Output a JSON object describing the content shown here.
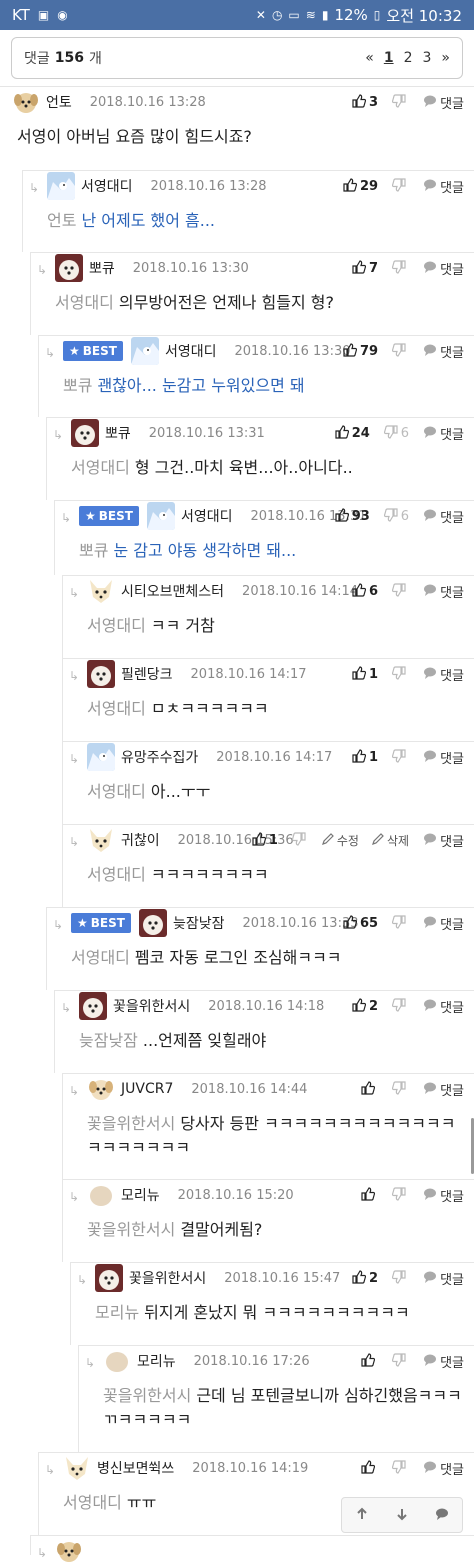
{
  "status": {
    "carrier": "KT",
    "battery": "12%",
    "time": "오전 10:32"
  },
  "header": {
    "label": "댓글",
    "count": "156",
    "unit": "개",
    "pages": [
      "«",
      "1",
      "2",
      "3",
      "»"
    ]
  },
  "best_label": "BEST",
  "reply_label": "댓글",
  "edit_label": "수정",
  "delete_label": "삭제",
  "comments": [
    {
      "nick": "언토",
      "date": "2018.10.16 13:28",
      "up": "3",
      "down": "",
      "mention": "",
      "text": "서영이 아버님 요즘 많이 힘드시죠?"
    },
    {
      "nick": "서영대디",
      "date": "2018.10.16 13:28",
      "up": "29",
      "down": "",
      "mention": "언토",
      "text": "난 어제도 했어 흠..."
    },
    {
      "nick": "뽀큐",
      "date": "2018.10.16 13:30",
      "up": "7",
      "down": "",
      "mention": "서영대디",
      "text": "의무방어전은 언제나 힘들지 형?"
    },
    {
      "nick": "서영대디",
      "date": "2018.10.16 13:30",
      "up": "79",
      "down": "",
      "mention": "뽀큐",
      "text": "괜찮아... 눈감고 누워있으면 돼"
    },
    {
      "nick": "뽀큐",
      "date": "2018.10.16 13:31",
      "up": "24",
      "down": "6",
      "mention": "서영대디",
      "text": "형 그건..마치 육변...아..아니다.."
    },
    {
      "nick": "서영대디",
      "date": "2018.10.16 13:31",
      "up": "93",
      "down": "6",
      "mention": "뽀큐",
      "text": "눈 감고 야동 생각하면 돼..."
    },
    {
      "nick": "시티오브맨체스터",
      "date": "2018.10.16 14:14",
      "up": "6",
      "down": "",
      "mention": "서영대디",
      "text": "ㅋㅋ 거참"
    },
    {
      "nick": "필렌당크",
      "date": "2018.10.16 14:17",
      "up": "1",
      "down": "",
      "mention": "서영대디",
      "text": "ㅁㅊㅋㅋㅋㅋㅋㅋ"
    },
    {
      "nick": "유망주수집가",
      "date": "2018.10.16 14:17",
      "up": "1",
      "down": "",
      "mention": "서영대디",
      "text": "아...ㅜㅜ"
    },
    {
      "nick": "귀찮이",
      "date": "2018.10.16 15:36",
      "up": "1",
      "down": "",
      "mention": "서영대디",
      "text": "ㅋㅋㅋㅋㅋㅋㅋㅋ"
    },
    {
      "nick": "늦잠낮잠",
      "date": "2018.10.16 13:33",
      "up": "65",
      "down": "",
      "mention": "서영대디",
      "text": "펨코 자동 로그인 조심해ㅋㅋㅋ"
    },
    {
      "nick": "꽃을위한서시",
      "date": "2018.10.16 14:18",
      "up": "2",
      "down": "",
      "mention": "늦잠낮잠",
      "text": "...언제쯤 잊힐래야"
    },
    {
      "nick": "JUVCR7",
      "date": "2018.10.16 14:44",
      "up": "",
      "down": "",
      "mention": "꽃을위한서시",
      "text": "당사자 등판 ㅋㅋㅋㅋㅋㅋㅋㅋㅋㅋㅋㅋㅋㅋㅋㅋㅋㅋㅋㅋ"
    },
    {
      "nick": "모리뉴",
      "date": "2018.10.16 15:20",
      "up": "",
      "down": "",
      "mention": "꽃을위한서시",
      "text": "결말어케됨?"
    },
    {
      "nick": "꽃을위한서시",
      "date": "2018.10.16 15:47",
      "up": "2",
      "down": "",
      "mention": "모리뉴",
      "text": "뒤지게 혼났지 뭐 ㅋㅋㅋㅋㅋㅋㅋㅋㅋㅋ"
    },
    {
      "nick": "모리뉴",
      "date": "2018.10.16 17:26",
      "up": "",
      "down": "",
      "mention": "꽃을위한서시",
      "text": "근데 님 포텐글보니까 심하긴했음ㅋㅋㅋㄲㅋㅋㅋㅋㅋ"
    },
    {
      "nick": "병신보면쒹쓰",
      "date": "2018.10.16 14:19",
      "up": "",
      "down": "",
      "mention": "서영대디",
      "text": "ㅠㅠ"
    },
    {
      "nick": "",
      "date": "",
      "up": "",
      "down": "",
      "mention": "",
      "text": ""
    }
  ]
}
